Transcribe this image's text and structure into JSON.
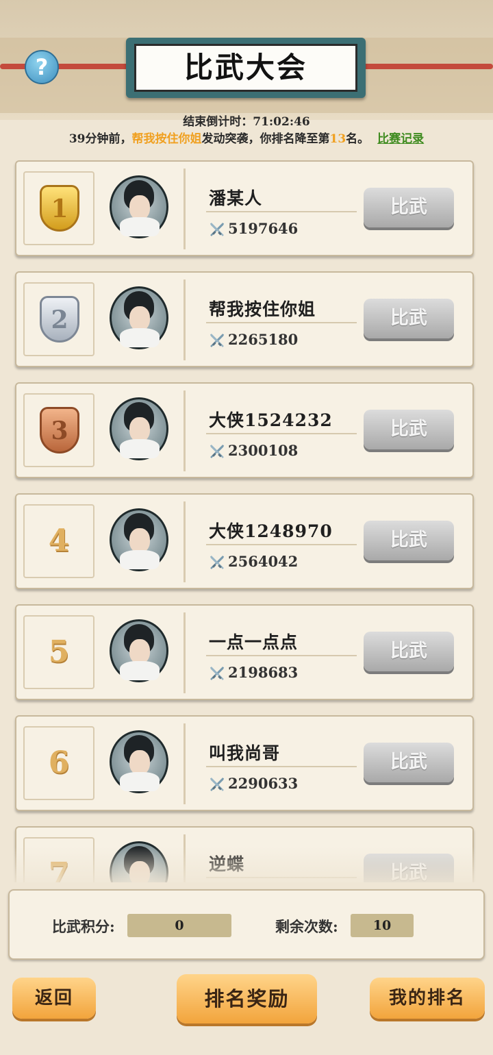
{
  "header": {
    "title": "比武大会",
    "help_label": "?"
  },
  "countdown": {
    "label": "结束倒计时：",
    "value": "71:02:46"
  },
  "notice": {
    "prefix": "39分钟前，",
    "attacker": "帮我按住你姐",
    "middle": "发动突袭，你排名降至第",
    "rank": "13",
    "suffix": "名。",
    "record_link": "比赛记录"
  },
  "rankings": [
    {
      "rank": "1",
      "name": "潘某人",
      "power": "5197646",
      "button": "比武",
      "badge": "gold"
    },
    {
      "rank": "2",
      "name": "帮我按住你姐",
      "power": "2265180",
      "button": "比武",
      "badge": "silver"
    },
    {
      "rank": "3",
      "name": "大侠1524232",
      "power": "2300108",
      "button": "比武",
      "badge": "bronze"
    },
    {
      "rank": "4",
      "name": "大侠1248970",
      "power": "2564042",
      "button": "比武",
      "badge": "plain"
    },
    {
      "rank": "5",
      "name": "一点一点点",
      "power": "2198683",
      "button": "比武",
      "badge": "plain"
    },
    {
      "rank": "6",
      "name": "叫我尚哥",
      "power": "2290633",
      "button": "比武",
      "badge": "plain"
    },
    {
      "rank": "7",
      "name": "逆蝶",
      "power": "",
      "button": "比武",
      "badge": "plain"
    }
  ],
  "stats": {
    "score_label": "比武积分:",
    "score_value": "0",
    "remaining_label": "剩余次数:",
    "remaining_value": "10"
  },
  "footer": {
    "back": "返回",
    "reward": "排名奖励",
    "my_rank": "我的排名"
  },
  "colors": {
    "accent_orange": "#f2a43c",
    "highlight": "#f0a020",
    "link_green": "#3e8b1f",
    "title_board": "#3c6f74"
  }
}
